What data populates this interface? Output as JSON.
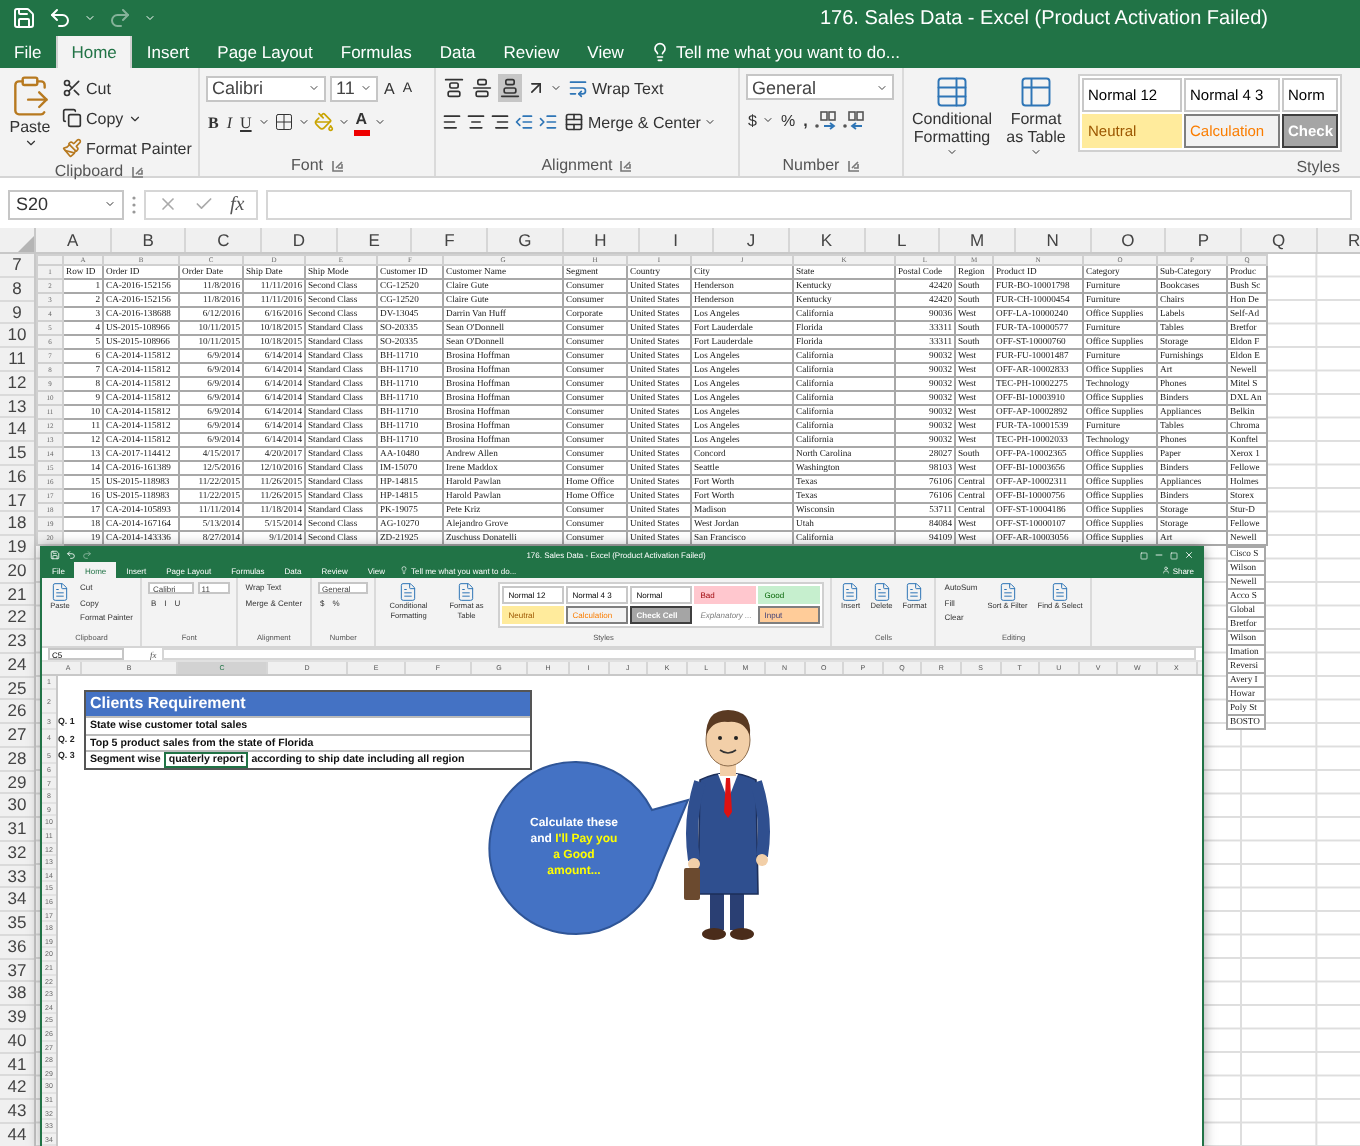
{
  "window": {
    "title": "176. Sales Data - Excel (Product Activation Failed)"
  },
  "tabs": [
    {
      "label": "File",
      "selected": false
    },
    {
      "label": "Home",
      "selected": true
    },
    {
      "label": "Insert",
      "selected": false
    },
    {
      "label": "Page Layout",
      "selected": false
    },
    {
      "label": "Formulas",
      "selected": false
    },
    {
      "label": "Data",
      "selected": false
    },
    {
      "label": "Review",
      "selected": false
    },
    {
      "label": "View",
      "selected": false
    }
  ],
  "tell_me": "Tell me what you want to do...",
  "clipboard": {
    "paste": "Paste",
    "cut": "Cut",
    "copy": "Copy",
    "format_painter": "Format Painter",
    "label": "Clipboard"
  },
  "font": {
    "name": "Calibri",
    "size": "11",
    "grow": "A",
    "shrink": "A",
    "bold": "B",
    "italic": "I",
    "underline": "U",
    "fore_letter": "A",
    "label": "Font"
  },
  "alignment": {
    "vertical": [
      {
        "selected": false
      },
      {
        "selected": false
      },
      {
        "selected": true
      }
    ],
    "wrap": "Wrap Text",
    "merge": "Merge & Center",
    "label": "Alignment"
  },
  "number": {
    "format": "General",
    "currency": "$",
    "percent": "%",
    "comma": ",",
    "label": "Number"
  },
  "styles": {
    "conditional": "Conditional Formatting",
    "format_table": "Format as Table",
    "label": "Styles",
    "gallery": [
      {
        "label": "Normal 12",
        "kind": "normal"
      },
      {
        "label": "Normal 4 3",
        "kind": "normal"
      },
      {
        "label": "Norm",
        "kind": "normal"
      },
      {
        "label": "Neutral",
        "kind": "neutral"
      },
      {
        "label": "Calculation",
        "kind": "calculation"
      },
      {
        "label": "Check",
        "kind": "check"
      }
    ]
  },
  "name_box": "S20",
  "function_label": "fx",
  "columns": [
    "A",
    "B",
    "C",
    "D",
    "E",
    "F",
    "G",
    "H",
    "I",
    "J",
    "K",
    "L",
    "M",
    "N",
    "O",
    "P",
    "Q",
    "R"
  ],
  "rows": [
    "7",
    "8",
    "9",
    "10",
    "11",
    "12",
    "13",
    "14",
    "15",
    "16",
    "17",
    "18",
    "19",
    "20",
    "21",
    "22",
    "23",
    "24",
    "25",
    "26",
    "27",
    "28",
    "29",
    "30",
    "31",
    "32",
    "33",
    "34",
    "35",
    "36",
    "37",
    "38",
    "39",
    "40",
    "41",
    "42",
    "43",
    "44"
  ],
  "data_table": {
    "letters": [
      "A",
      "B",
      "C",
      "D",
      "E",
      "F",
      "G",
      "H",
      "I",
      "J",
      "K",
      "L",
      "M",
      "N",
      "O",
      "P",
      "Q"
    ],
    "header": {
      "n": "1",
      "cells": [
        "Row ID",
        "Order ID",
        "Order Date",
        "Ship Date",
        "Ship Mode",
        "Customer ID",
        "Customer Name",
        "Segment",
        "Country",
        "City",
        "State",
        "Postal Code",
        "Region",
        "Product ID",
        "Category",
        "Sub-Category",
        "Produc"
      ]
    },
    "rows": [
      {
        "n": "2",
        "cells": [
          "1",
          "CA-2016-152156",
          "11/8/2016",
          "11/11/2016",
          "Second Class",
          "CG-12520",
          "Claire Gute",
          "Consumer",
          "United States",
          "Henderson",
          "Kentucky",
          "42420",
          "South",
          "FUR-BO-10001798",
          "Furniture",
          "Bookcases",
          "Bush Sc"
        ]
      },
      {
        "n": "3",
        "cells": [
          "2",
          "CA-2016-152156",
          "11/8/2016",
          "11/11/2016",
          "Second Class",
          "CG-12520",
          "Claire Gute",
          "Consumer",
          "United States",
          "Henderson",
          "Kentucky",
          "42420",
          "South",
          "FUR-CH-10000454",
          "Furniture",
          "Chairs",
          "Hon De"
        ]
      },
      {
        "n": "4",
        "cells": [
          "3",
          "CA-2016-138688",
          "6/12/2016",
          "6/16/2016",
          "Second Class",
          "DV-13045",
          "Darrin Van Huff",
          "Corporate",
          "United States",
          "Los Angeles",
          "California",
          "90036",
          "West",
          "OFF-LA-10000240",
          "Office Supplies",
          "Labels",
          "Self-Ad"
        ]
      },
      {
        "n": "5",
        "cells": [
          "4",
          "US-2015-108966",
          "10/11/2015",
          "10/18/2015",
          "Standard Class",
          "SO-20335",
          "Sean O'Donnell",
          "Consumer",
          "United States",
          "Fort Lauderdale",
          "Florida",
          "33311",
          "South",
          "FUR-TA-10000577",
          "Furniture",
          "Tables",
          "Bretfor"
        ]
      },
      {
        "n": "6",
        "cells": [
          "5",
          "US-2015-108966",
          "10/11/2015",
          "10/18/2015",
          "Standard Class",
          "SO-20335",
          "Sean O'Donnell",
          "Consumer",
          "United States",
          "Fort Lauderdale",
          "Florida",
          "33311",
          "South",
          "OFF-ST-10000760",
          "Office Supplies",
          "Storage",
          "Eldon F"
        ]
      },
      {
        "n": "7",
        "cells": [
          "6",
          "CA-2014-115812",
          "6/9/2014",
          "6/14/2014",
          "Standard Class",
          "BH-11710",
          "Brosina Hoffman",
          "Consumer",
          "United States",
          "Los Angeles",
          "California",
          "90032",
          "West",
          "FUR-FU-10001487",
          "Furniture",
          "Furnishings",
          "Eldon E"
        ]
      },
      {
        "n": "8",
        "cells": [
          "7",
          "CA-2014-115812",
          "6/9/2014",
          "6/14/2014",
          "Standard Class",
          "BH-11710",
          "Brosina Hoffman",
          "Consumer",
          "United States",
          "Los Angeles",
          "California",
          "90032",
          "West",
          "OFF-AR-10002833",
          "Office Supplies",
          "Art",
          "Newell"
        ]
      },
      {
        "n": "9",
        "cells": [
          "8",
          "CA-2014-115812",
          "6/9/2014",
          "6/14/2014",
          "Standard Class",
          "BH-11710",
          "Brosina Hoffman",
          "Consumer",
          "United States",
          "Los Angeles",
          "California",
          "90032",
          "West",
          "TEC-PH-10002275",
          "Technology",
          "Phones",
          "Mitel S"
        ]
      },
      {
        "n": "10",
        "cells": [
          "9",
          "CA-2014-115812",
          "6/9/2014",
          "6/14/2014",
          "Standard Class",
          "BH-11710",
          "Brosina Hoffman",
          "Consumer",
          "United States",
          "Los Angeles",
          "California",
          "90032",
          "West",
          "OFF-BI-10003910",
          "Office Supplies",
          "Binders",
          "DXL An"
        ]
      },
      {
        "n": "11",
        "cells": [
          "10",
          "CA-2014-115812",
          "6/9/2014",
          "6/14/2014",
          "Standard Class",
          "BH-11710",
          "Brosina Hoffman",
          "Consumer",
          "United States",
          "Los Angeles",
          "California",
          "90032",
          "West",
          "OFF-AP-10002892",
          "Office Supplies",
          "Appliances",
          "Belkin"
        ]
      },
      {
        "n": "12",
        "cells": [
          "11",
          "CA-2014-115812",
          "6/9/2014",
          "6/14/2014",
          "Standard Class",
          "BH-11710",
          "Brosina Hoffman",
          "Consumer",
          "United States",
          "Los Angeles",
          "California",
          "90032",
          "West",
          "FUR-TA-10001539",
          "Furniture",
          "Tables",
          "Chroma"
        ]
      },
      {
        "n": "13",
        "cells": [
          "12",
          "CA-2014-115812",
          "6/9/2014",
          "6/14/2014",
          "Standard Class",
          "BH-11710",
          "Brosina Hoffman",
          "Consumer",
          "United States",
          "Los Angeles",
          "California",
          "90032",
          "West",
          "TEC-PH-10002033",
          "Technology",
          "Phones",
          "Konftel"
        ]
      },
      {
        "n": "14",
        "cells": [
          "13",
          "CA-2017-114412",
          "4/15/2017",
          "4/20/2017",
          "Standard Class",
          "AA-10480",
          "Andrew Allen",
          "Consumer",
          "United States",
          "Concord",
          "North Carolina",
          "28027",
          "South",
          "OFF-PA-10002365",
          "Office Supplies",
          "Paper",
          "Xerox 1"
        ]
      },
      {
        "n": "15",
        "cells": [
          "14",
          "CA-2016-161389",
          "12/5/2016",
          "12/10/2016",
          "Standard Class",
          "IM-15070",
          "Irene Maddox",
          "Consumer",
          "United States",
          "Seattle",
          "Washington",
          "98103",
          "West",
          "OFF-BI-10003656",
          "Office Supplies",
          "Binders",
          "Fellowe"
        ]
      },
      {
        "n": "16",
        "cells": [
          "15",
          "US-2015-118983",
          "11/22/2015",
          "11/26/2015",
          "Standard Class",
          "HP-14815",
          "Harold Pawlan",
          "Home Office",
          "United States",
          "Fort Worth",
          "Texas",
          "76106",
          "Central",
          "OFF-AP-10002311",
          "Office Supplies",
          "Appliances",
          "Holmes"
        ]
      },
      {
        "n": "17",
        "cells": [
          "16",
          "US-2015-118983",
          "11/22/2015",
          "11/26/2015",
          "Standard Class",
          "HP-14815",
          "Harold Pawlan",
          "Home Office",
          "United States",
          "Fort Worth",
          "Texas",
          "76106",
          "Central",
          "OFF-BI-10000756",
          "Office Supplies",
          "Binders",
          "Storex"
        ]
      },
      {
        "n": "18",
        "cells": [
          "17",
          "CA-2014-105893",
          "11/11/2014",
          "11/18/2014",
          "Standard Class",
          "PK-19075",
          "Pete Kriz",
          "Consumer",
          "United States",
          "Madison",
          "Wisconsin",
          "53711",
          "Central",
          "OFF-ST-10004186",
          "Office Supplies",
          "Storage",
          "Stur-D"
        ]
      },
      {
        "n": "19",
        "cells": [
          "18",
          "CA-2014-167164",
          "5/13/2014",
          "5/15/2014",
          "Second Class",
          "AG-10270",
          "Alejandro Grove",
          "Consumer",
          "United States",
          "West Jordan",
          "Utah",
          "84084",
          "West",
          "OFF-ST-10000107",
          "Office Supplies",
          "Storage",
          "Fellowe"
        ]
      },
      {
        "n": "20",
        "cells": [
          "19",
          "CA-2014-143336",
          "8/27/2014",
          "9/1/2014",
          "Second Class",
          "ZD-21925",
          "Zuschuss Donatelli",
          "Consumer",
          "United States",
          "San Francisco",
          "California",
          "94109",
          "West",
          "OFF-AR-10003056",
          "Office Supplies",
          "Art",
          "Newell"
        ]
      }
    ],
    "product_tail": [
      "Cisco S",
      "Wilson",
      "Newell",
      "Acco S",
      "Global",
      "Bretfor",
      "Wilson",
      "Imation",
      "Reversi",
      "Avery I",
      "Howar",
      "Poly St",
      "BOSTO"
    ]
  },
  "inner_window": {
    "title": "176. Sales Data - Excel (Product Activation Failed)",
    "tabs": [
      {
        "label": "File",
        "selected": false
      },
      {
        "label": "Home",
        "selected": true
      },
      {
        "label": "Insert",
        "selected": false
      },
      {
        "label": "Page Layout",
        "selected": false
      },
      {
        "label": "Formulas",
        "selected": false
      },
      {
        "label": "Data",
        "selected": false
      },
      {
        "label": "Review",
        "selected": false
      },
      {
        "label": "View",
        "selected": false
      }
    ],
    "tell_me": "Tell me what you want to do...",
    "share": "Share",
    "groups": [
      {
        "label": "Clipboard",
        "parts": [
          {
            "kind": "big",
            "text": "Paste"
          },
          {
            "kind": "stack",
            "lines": [
              {
                "items": [
                  {
                    "text": "Cut",
                    "kind": "button"
                  }
                ]
              },
              {
                "items": [
                  {
                    "text": "Copy",
                    "kind": "button"
                  }
                ]
              },
              {
                "items": [
                  {
                    "text": "Format Painter",
                    "kind": "button"
                  }
                ]
              }
            ]
          }
        ]
      },
      {
        "label": "Font",
        "parts": [
          {
            "kind": "stack",
            "lines": [
              {
                "items": [
                  {
                    "text": "Calibri",
                    "kind": "field"
                  },
                  {
                    "text": "11",
                    "kind": "field"
                  }
                ]
              },
              {
                "items": [
                  {
                    "text": "B",
                    "kind": "button"
                  },
                  {
                    "text": "I",
                    "kind": "button"
                  },
                  {
                    "text": "U",
                    "kind": "button"
                  }
                ]
              }
            ]
          }
        ]
      },
      {
        "label": "Alignment",
        "parts": [
          {
            "kind": "stack",
            "lines": [
              {
                "items": [
                  {
                    "text": "Wrap Text",
                    "kind": "button"
                  }
                ]
              },
              {
                "items": [
                  {
                    "text": "Merge & Center",
                    "kind": "button"
                  }
                ]
              }
            ]
          }
        ]
      },
      {
        "label": "Number",
        "parts": [
          {
            "kind": "stack",
            "lines": [
              {
                "items": [
                  {
                    "text": "General",
                    "kind": "field"
                  }
                ]
              },
              {
                "items": [
                  {
                    "text": "$",
                    "kind": "button"
                  },
                  {
                    "text": "%",
                    "kind": "button"
                  }
                ]
              }
            ]
          }
        ]
      },
      {
        "label": "Styles",
        "parts": [
          {
            "kind": "big",
            "text": "Conditional Formatting"
          },
          {
            "kind": "big",
            "text": "Format as Table"
          },
          {
            "kind": "gallery",
            "cells": [
              {
                "label": "Normal 12",
                "kind": "normal"
              },
              {
                "label": "Normal 4 3",
                "kind": "normal"
              },
              {
                "label": "Normal",
                "kind": "normal"
              },
              {
                "label": "Bad",
                "kind": "bad"
              },
              {
                "label": "Good",
                "kind": "good"
              },
              {
                "label": "Neutral",
                "kind": "neutral"
              },
              {
                "label": "Calculation",
                "kind": "calculation"
              },
              {
                "label": "Check Cell",
                "kind": "check"
              },
              {
                "label": "Explanatory ...",
                "kind": "explanatory"
              },
              {
                "label": "Input",
                "kind": "input"
              }
            ]
          }
        ]
      },
      {
        "label": "Cells",
        "parts": [
          {
            "kind": "big",
            "text": "Insert"
          },
          {
            "kind": "big",
            "text": "Delete"
          },
          {
            "kind": "big",
            "text": "Format"
          }
        ]
      },
      {
        "label": "Editing",
        "parts": [
          {
            "kind": "stack",
            "lines": [
              {
                "items": [
                  {
                    "text": "AutoSum",
                    "kind": "button"
                  }
                ]
              },
              {
                "items": [
                  {
                    "text": "Fill",
                    "kind": "button"
                  }
                ]
              },
              {
                "items": [
                  {
                    "text": "Clear",
                    "kind": "button"
                  }
                ]
              }
            ]
          },
          {
            "kind": "big",
            "text": "Sort & Filter"
          },
          {
            "kind": "big",
            "text": "Find & Select"
          }
        ]
      }
    ],
    "name_box": "C5",
    "function_label": "fx",
    "columns": [
      {
        "label": "A",
        "selected": false
      },
      {
        "label": "B",
        "selected": false
      },
      {
        "label": "C",
        "selected": true
      },
      {
        "label": "D",
        "selected": false
      },
      {
        "label": "E",
        "selected": false
      },
      {
        "label": "F",
        "selected": false
      },
      {
        "label": "G",
        "selected": false
      },
      {
        "label": "H",
        "selected": false
      },
      {
        "label": "I",
        "selected": false
      },
      {
        "label": "J",
        "selected": false
      },
      {
        "label": "K",
        "selected": false
      },
      {
        "label": "L",
        "selected": false
      },
      {
        "label": "M",
        "selected": false
      },
      {
        "label": "N",
        "selected": false
      },
      {
        "label": "O",
        "selected": false
      },
      {
        "label": "P",
        "selected": false
      },
      {
        "label": "Q",
        "selected": false
      },
      {
        "label": "R",
        "selected": false
      },
      {
        "label": "S",
        "selected": false
      },
      {
        "label": "T",
        "selected": false
      },
      {
        "label": "U",
        "selected": false
      },
      {
        "label": "V",
        "selected": false
      },
      {
        "label": "W",
        "selected": false
      },
      {
        "label": "X",
        "selected": false
      }
    ],
    "rows": [
      "1",
      "2",
      "3",
      "4",
      "5",
      "6",
      "7",
      "8",
      "9",
      "10",
      "11",
      "12",
      "13",
      "14",
      "15",
      "16",
      "17",
      "18",
      "19",
      "20",
      "21",
      "22",
      "23",
      "24",
      "25",
      "26",
      "27",
      "28",
      "29",
      "30",
      "31",
      "32",
      "33",
      "34"
    ],
    "requirement": {
      "title": "Clients Requirement",
      "questions": [
        {
          "label": "Q. 1",
          "cells": [
            {
              "text": "State wise customer total sales",
              "selected": false
            }
          ]
        },
        {
          "label": "Q. 2",
          "cells": [
            {
              "text": "Top 5 product sales from the state of Florida",
              "selected": false
            }
          ]
        },
        {
          "label": "Q. 3",
          "cells": [
            {
              "text": "Segment wise",
              "selected": false
            },
            {
              "text": "quaterly report",
              "selected": true
            },
            {
              "text": "according to ship date including all region",
              "selected": false
            }
          ]
        }
      ]
    },
    "bubble": {
      "segments": [
        {
          "text": "Calculate these and",
          "highlight": false
        },
        {
          "text": "I'll Pay you a Good amount...",
          "highlight": true
        }
      ]
    }
  }
}
